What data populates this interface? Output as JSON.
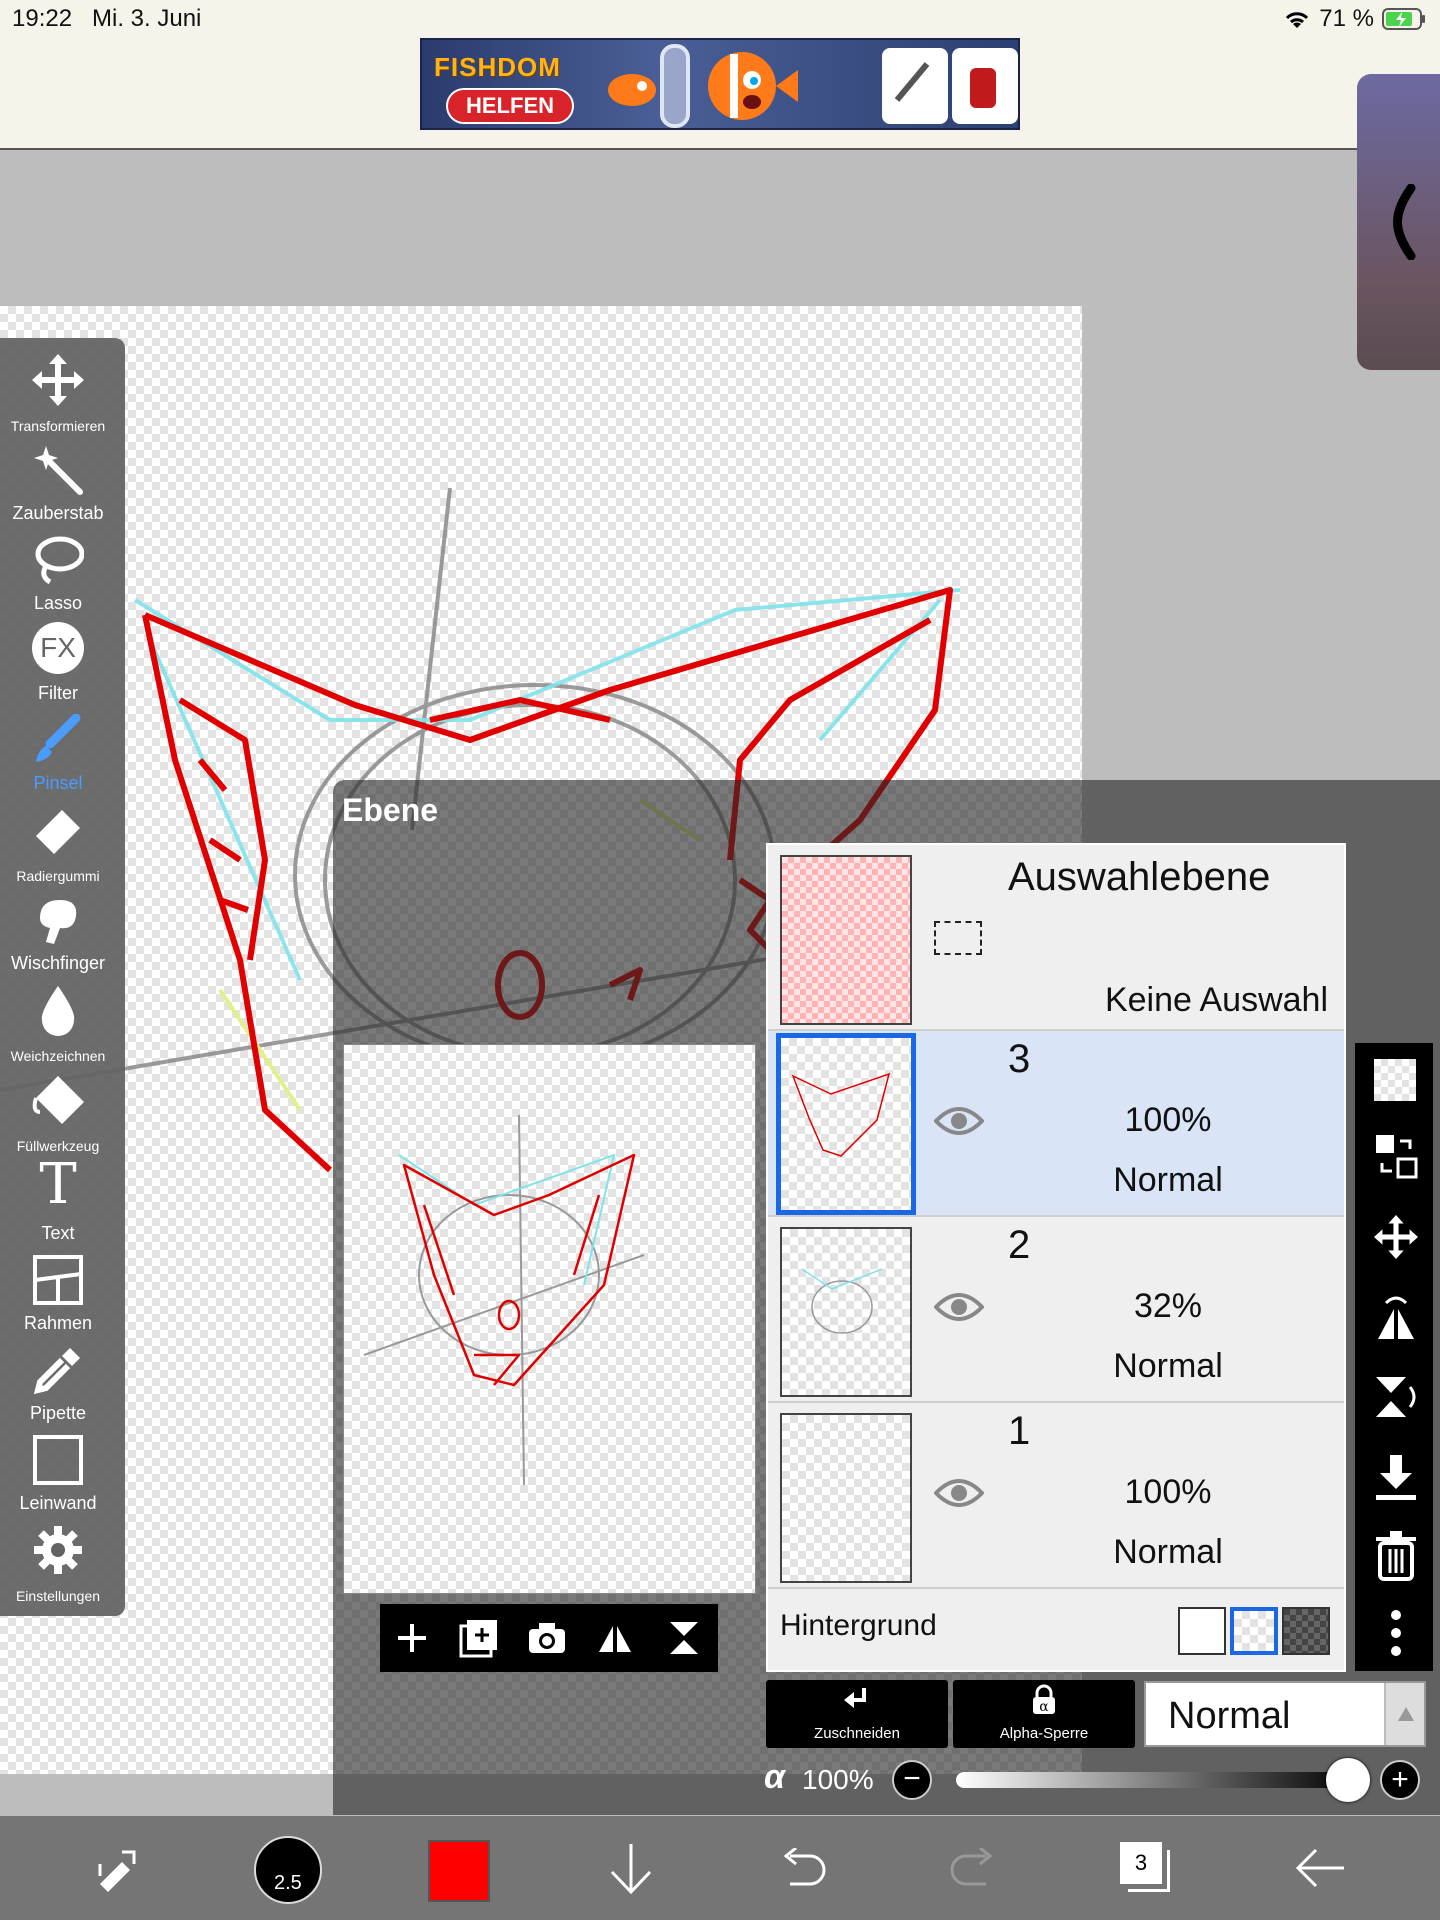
{
  "status_bar": {
    "time": "19:22",
    "date": "Mi. 3. Juni",
    "battery": "71 %"
  },
  "ad": {
    "title": "FISHDOM",
    "button": "HELFEN"
  },
  "tools": [
    {
      "label": "Transformieren"
    },
    {
      "label": "Zauberstab"
    },
    {
      "label": "Lasso"
    },
    {
      "label": "Filter",
      "icon_text": "FX"
    },
    {
      "label": "Pinsel"
    },
    {
      "label": "Radiergummi"
    },
    {
      "label": "Wischfinger"
    },
    {
      "label": "Weichzeichnen"
    },
    {
      "label": "Füllwerkzeug"
    },
    {
      "label": "Text",
      "icon_text": "T"
    },
    {
      "label": "Rahmen"
    },
    {
      "label": "Pipette"
    },
    {
      "label": "Leinwand"
    },
    {
      "label": "Einstellungen"
    }
  ],
  "active_tool": "Pinsel",
  "layer_panel": {
    "title": "Ebene",
    "selection_layer": {
      "name": "Auswahlebene",
      "status": "Keine Auswahl"
    },
    "layers": [
      {
        "number": "3",
        "opacity": "100%",
        "mode": "Normal",
        "selected": true
      },
      {
        "number": "2",
        "opacity": "32%",
        "mode": "Normal",
        "selected": false
      },
      {
        "number": "1",
        "opacity": "100%",
        "mode": "Normal",
        "selected": false
      }
    ],
    "background_label": "Hintergrund",
    "buttons": {
      "clip": "Zuschneiden",
      "alpha_lock": "Alpha-Sperre"
    },
    "blend_mode": "Normal",
    "alpha_symbol": "α",
    "alpha_value": "100%",
    "alpha_fraction": 1.0
  },
  "bottom_toolbar": {
    "brush_size": "2.5",
    "color": "#ff0000",
    "layer_count": "3"
  },
  "colors": {
    "accent": "#1a68e6",
    "active_tool": "#4a9cff",
    "stroke_red": "#e00000",
    "stroke_cyan": "#7fe3ea",
    "stroke_yellow": "#e3ef8a"
  }
}
